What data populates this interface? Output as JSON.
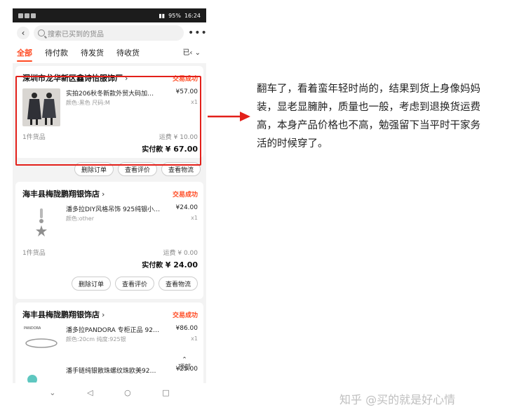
{
  "statusbar": {
    "battery": "95%",
    "time": "16:24"
  },
  "header": {
    "back_icon": "‹",
    "search_placeholder": "搜索已买到的货品",
    "more_icon": "•••"
  },
  "tabs": [
    {
      "label": "全部"
    },
    {
      "label": "待付款"
    },
    {
      "label": "待发货"
    },
    {
      "label": "待收货"
    }
  ],
  "tab_more": "已‹ ⌄",
  "orders": [
    {
      "store": "深圳市龙华新区鑫诗怡服饰厂",
      "status": "交易成功",
      "items": [
        {
          "title": "实拍206秋冬新款外贸大码加…",
          "price": "¥57.00",
          "spec": "颜色:黑色 尺码:M",
          "qty": "x1"
        }
      ],
      "count": "1件货品",
      "shipping": "运费 ¥ 10.00",
      "paid_label": "实付款",
      "paid_amount": "¥ 67.00",
      "actions": [
        "删除订单",
        "查看评价",
        "查看物流"
      ]
    },
    {
      "store": "海丰县梅陇鹏翔银饰店",
      "status": "交易成功",
      "items": [
        {
          "title": "潘多拉DIY风格吊饰 925纯银小…",
          "price": "¥24.00",
          "spec": "颜色:other",
          "qty": "x1"
        }
      ],
      "count": "1件货品",
      "shipping": "运费 ¥ 0.00",
      "paid_label": "实付款",
      "paid_amount": "¥ 24.00",
      "actions": [
        "删除订单",
        "查看评价",
        "查看物流"
      ]
    },
    {
      "store": "海丰县梅陇鹏翔银饰店",
      "status": "交易成功",
      "items": [
        {
          "title": "潘多拉PANDORA 专柜正品 92…",
          "price": "¥86.00",
          "spec": "颜色:20cm 纯度:925银",
          "qty": "x1"
        },
        {
          "title": "潘手链纯银散珠螺纹珠欧美92…",
          "price": "¥25.00",
          "spec": "",
          "qty": ""
        }
      ],
      "thumb_brand": "PANDORA"
    }
  ],
  "top_button": "顶部",
  "nav": {
    "back": "◁",
    "home": "○",
    "recent": "□",
    "down": "⌄"
  },
  "comment": "翻车了，看着蛮年轻时尚的，结果到货上身像妈妈装，显老显臃肿，质量也一般，考虑到退换货运费高，本身产品价格也不高，勉强留下当平时干家务活的时候穿了。",
  "watermark": "知乎 @买的就是好心情",
  "colors": {
    "accent": "#ff4a22",
    "highlight": "#e3201a"
  }
}
